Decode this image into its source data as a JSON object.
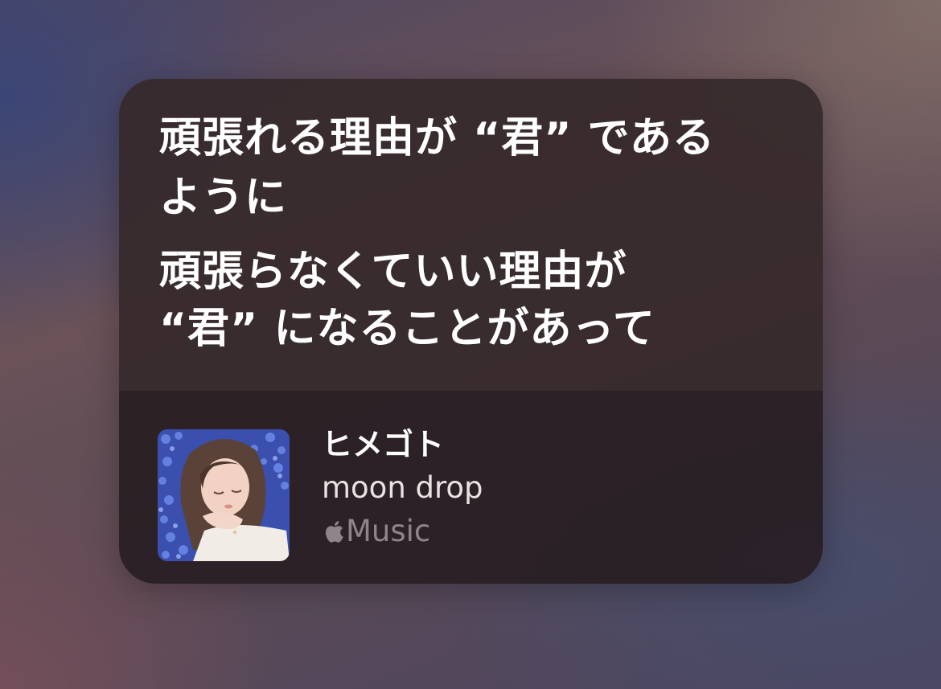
{
  "siri_card": {
    "lyrics": [
      "頑張れる理由が “君” である",
      "ように",
      "頑張らなくていい理由が",
      "“君” になることがあって"
    ],
    "song": {
      "title": "ヒメゴト",
      "artist": "moon drop",
      "service": {
        "icon": "apple-logo-icon",
        "label": "Music"
      },
      "artwork": "album-art-girl-among-blue-flowers"
    }
  }
}
